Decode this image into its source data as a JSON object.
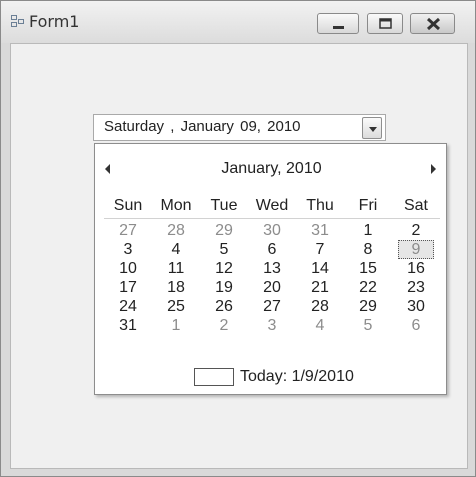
{
  "window": {
    "title": "Form1"
  },
  "datepicker": {
    "weekday": "Saturday",
    "sep1": ",",
    "month": "January",
    "day": "09,",
    "year": "2010"
  },
  "calendar": {
    "title": "January, 2010",
    "weekdays": [
      "Sun",
      "Mon",
      "Tue",
      "Wed",
      "Thu",
      "Fri",
      "Sat"
    ],
    "weeks": [
      [
        "27",
        "28",
        "29",
        "30",
        "31",
        "1",
        "2"
      ],
      [
        "3",
        "4",
        "5",
        "6",
        "7",
        "8",
        "9"
      ],
      [
        "10",
        "11",
        "12",
        "13",
        "14",
        "15",
        "16"
      ],
      [
        "17",
        "18",
        "19",
        "20",
        "21",
        "22",
        "23"
      ],
      [
        "24",
        "25",
        "26",
        "27",
        "28",
        "29",
        "30"
      ],
      [
        "31",
        "1",
        "2",
        "3",
        "4",
        "5",
        "6"
      ]
    ],
    "today_label": "Today: 1/9/2010"
  },
  "icons": {
    "app": "app-icon",
    "minimize": "minimize-icon",
    "maximize": "maximize-icon",
    "close": "close-icon",
    "dropdown": "dropdown-arrow-icon",
    "prev": "prev-month-icon",
    "next": "next-month-icon"
  }
}
